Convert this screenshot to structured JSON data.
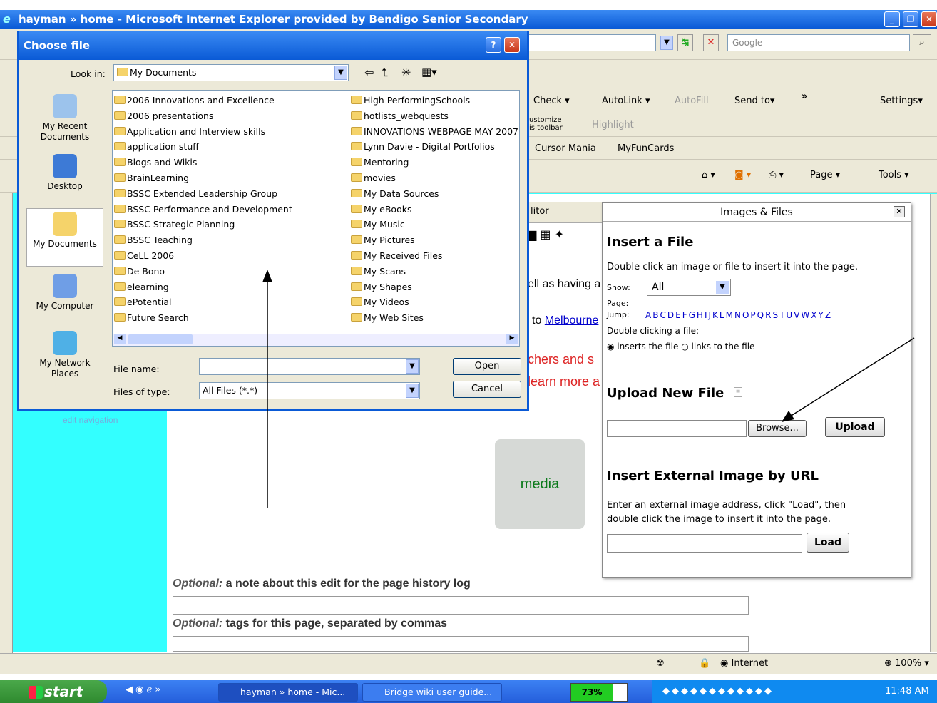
{
  "ie": {
    "title": "hayman » home - Microsoft Internet Explorer provided by Bendigo Senior Secondary",
    "search_placeholder": "Google",
    "toolbar2": {
      "check": "Check ▾",
      "autolink": "AutoLink ▾",
      "autofill": "AutoFill",
      "sendto": "Send to▾",
      "more": "»",
      "settings": "Settings▾"
    },
    "toolbar3": {
      "customize": "ustomize",
      "customize2": "is toolbar",
      "highlight": "Highlight"
    },
    "toolbar4": {
      "cursor": "Cursor Mania",
      "funcards": "MyFunCards"
    },
    "cmdbar": {
      "page": "Page ▾",
      "tools": "Tools ▾"
    }
  },
  "editor": {
    "label": "litor"
  },
  "page": {
    "line1": "ell as having a",
    "line2_prefix": "to ",
    "line2_link": "Melbourne",
    "red1": "chers and s",
    "red2": "learn more a",
    "edit_nav": "edit navigation",
    "media": "media",
    "opt1_i": "Optional:",
    "opt1": " a note about this edit for the page history log",
    "opt2_i": "Optional:",
    "opt2": " tags for this page, separated by commas"
  },
  "panel": {
    "title": "Images & Files",
    "insert_heading": "Insert a File",
    "insert_desc": "Double click an image or file to insert it into the page.",
    "show_label": "Show:",
    "show_value": "All",
    "page_label": "Page:",
    "jump_label": "Jump:",
    "letters": [
      "A",
      "B",
      "C",
      "D",
      "E",
      "F",
      "G",
      "H",
      "I",
      "J",
      "K",
      "L",
      "M",
      "N",
      "O",
      "P",
      "Q",
      "R",
      "S",
      "T",
      "U",
      "V",
      "W",
      "X",
      "Y",
      "Z"
    ],
    "dbl_label": "Double clicking a file:",
    "radio1": "inserts the file",
    "radio2": "links to the file",
    "upload_heading": "Upload New File",
    "browse": "Browse...",
    "upload": "Upload",
    "external_heading": "Insert External Image by URL",
    "external_desc1": "Enter an external image address, click \"Load\", then",
    "external_desc2": "double click the image to insert it into the page.",
    "load": "Load"
  },
  "dialog": {
    "title": "Choose file",
    "look_in_label": "Look in:",
    "look_in_value": "My Documents",
    "places": [
      "My Recent Documents",
      "Desktop",
      "My Documents",
      "My Computer",
      "My Network Places"
    ],
    "files_col1": [
      "2006 Innovations and Excellence",
      "2006 presentations",
      "Application and Interview skills",
      "application stuff",
      "Blogs and Wikis",
      "BrainLearning",
      "BSSC Extended Leadership Group",
      "BSSC Performance and Development",
      "BSSC Strategic Planning",
      "BSSC Teaching",
      "CeLL 2006",
      "De Bono",
      "elearning",
      "ePotential",
      "Future Search"
    ],
    "files_col2": [
      "High PerformingSchools",
      "hotlists_webquests",
      "INNOVATIONS WEBPAGE MAY 2007",
      "Lynn Davie - Digital Portfolios",
      "Mentoring",
      "movies",
      "My Data Sources",
      "My eBooks",
      "My Music",
      "My Pictures",
      "My Received Files",
      "My Scans",
      "My Shapes",
      "My Videos",
      "My Web Sites"
    ],
    "filename_label": "File name:",
    "filetype_label": "Files of type:",
    "filetype_value": "All Files (*.*)",
    "open": "Open",
    "cancel": "Cancel"
  },
  "status": {
    "zone": "Internet",
    "zoom": "100%"
  },
  "taskbar": {
    "start": "start",
    "task1": "hayman » home - Mic...",
    "task2": "Bridge wiki user guide...",
    "battery": "73%",
    "clock": "11:48 AM"
  }
}
